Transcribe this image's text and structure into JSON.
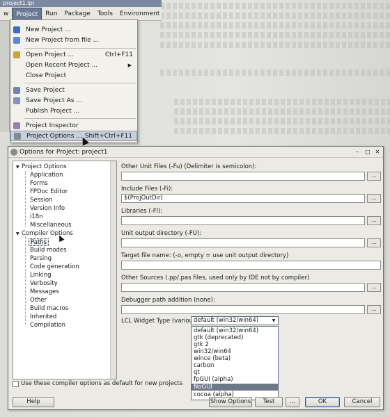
{
  "ide": {
    "title": "project1.lpi",
    "menubar": [
      "w",
      "Project",
      "Run",
      "Package",
      "Tools",
      "Environment"
    ],
    "active_menu": "Project"
  },
  "project_menu": {
    "items": [
      {
        "label": "New Project ...",
        "shortcut": "",
        "submenu": false
      },
      {
        "label": "New Project from file ...",
        "shortcut": "",
        "submenu": false
      },
      {
        "label": "Open Project ...",
        "shortcut": "Ctrl+F11",
        "submenu": false
      },
      {
        "label": "Open Recent Project ...",
        "shortcut": "",
        "submenu": true
      },
      {
        "label": "Close Project",
        "shortcut": "",
        "submenu": false
      },
      {
        "label": "Save Project",
        "shortcut": "",
        "submenu": false
      },
      {
        "label": "Save Project As ...",
        "shortcut": "",
        "submenu": false
      },
      {
        "label": "Publish Project ...",
        "shortcut": "",
        "submenu": false
      },
      {
        "label": "Project Inspector",
        "shortcut": "",
        "submenu": false
      },
      {
        "label": "Project Options ...",
        "shortcut": "Shift+Ctrl+F11",
        "submenu": false
      }
    ],
    "highlighted": "Project Options ..."
  },
  "dialog": {
    "title": "Options for Project: project1",
    "tree": {
      "project_options": {
        "label": "Project Options",
        "children": [
          "Application",
          "Forms",
          "FPDoc Editor",
          "Session",
          "Version Info",
          "i18n",
          "Miscellaneous"
        ]
      },
      "compiler_options": {
        "label": "Compiler Options",
        "children": [
          "Paths",
          "Build modes",
          "Parsing",
          "Code generation",
          "Linking",
          "Verbosity",
          "Messages",
          "Other",
          "Build macros",
          "Inherited",
          "Compilation"
        ]
      },
      "selected": "Paths"
    },
    "fields": {
      "other_unit_files": {
        "label": "Other Unit Files (-Fu) (Delimiter is semicolon):",
        "value": ""
      },
      "include_files": {
        "label": "Include Files (-Fi):",
        "value": "$(ProjOutDir)"
      },
      "libraries": {
        "label": "Libraries (-Fl):",
        "value": ""
      },
      "unit_output": {
        "label": "Unit output directory (-FU):",
        "value": ""
      },
      "target_file": {
        "label": "Target file name: (-o, empty = use unit output directory)",
        "value": ""
      },
      "other_sources": {
        "label": "Other Sources (.pp/.pas files, used only by IDE not by compiler)",
        "value": ""
      },
      "debugger_path": {
        "label": "Debugger path addition (none):",
        "value": ""
      }
    },
    "ellipsis": "...",
    "lcl_widget": {
      "label": "LCL Widget Type (various)",
      "selected": "default (win32/win64)",
      "options": [
        "default (win32/win64)",
        "gtk (deprecated)",
        "gtk 2",
        "win32/win64",
        "wince (beta)",
        "carbon",
        "qt",
        "fpGUI (alpha)",
        "NoGUI",
        "cocoa (alpha)"
      ],
      "highlighted": "NoGUI"
    },
    "default_checkbox": "Use these compiler options as default for new projects",
    "buttons": {
      "help": "Help",
      "show_options": "Show Options",
      "test": "Test",
      "more": "...",
      "ok": "OK",
      "cancel": "Cancel"
    }
  },
  "colors": {
    "menu_highlight": "#c9cfd9",
    "list_highlight": "#6f7787",
    "active_menu": "#6c7c95"
  }
}
